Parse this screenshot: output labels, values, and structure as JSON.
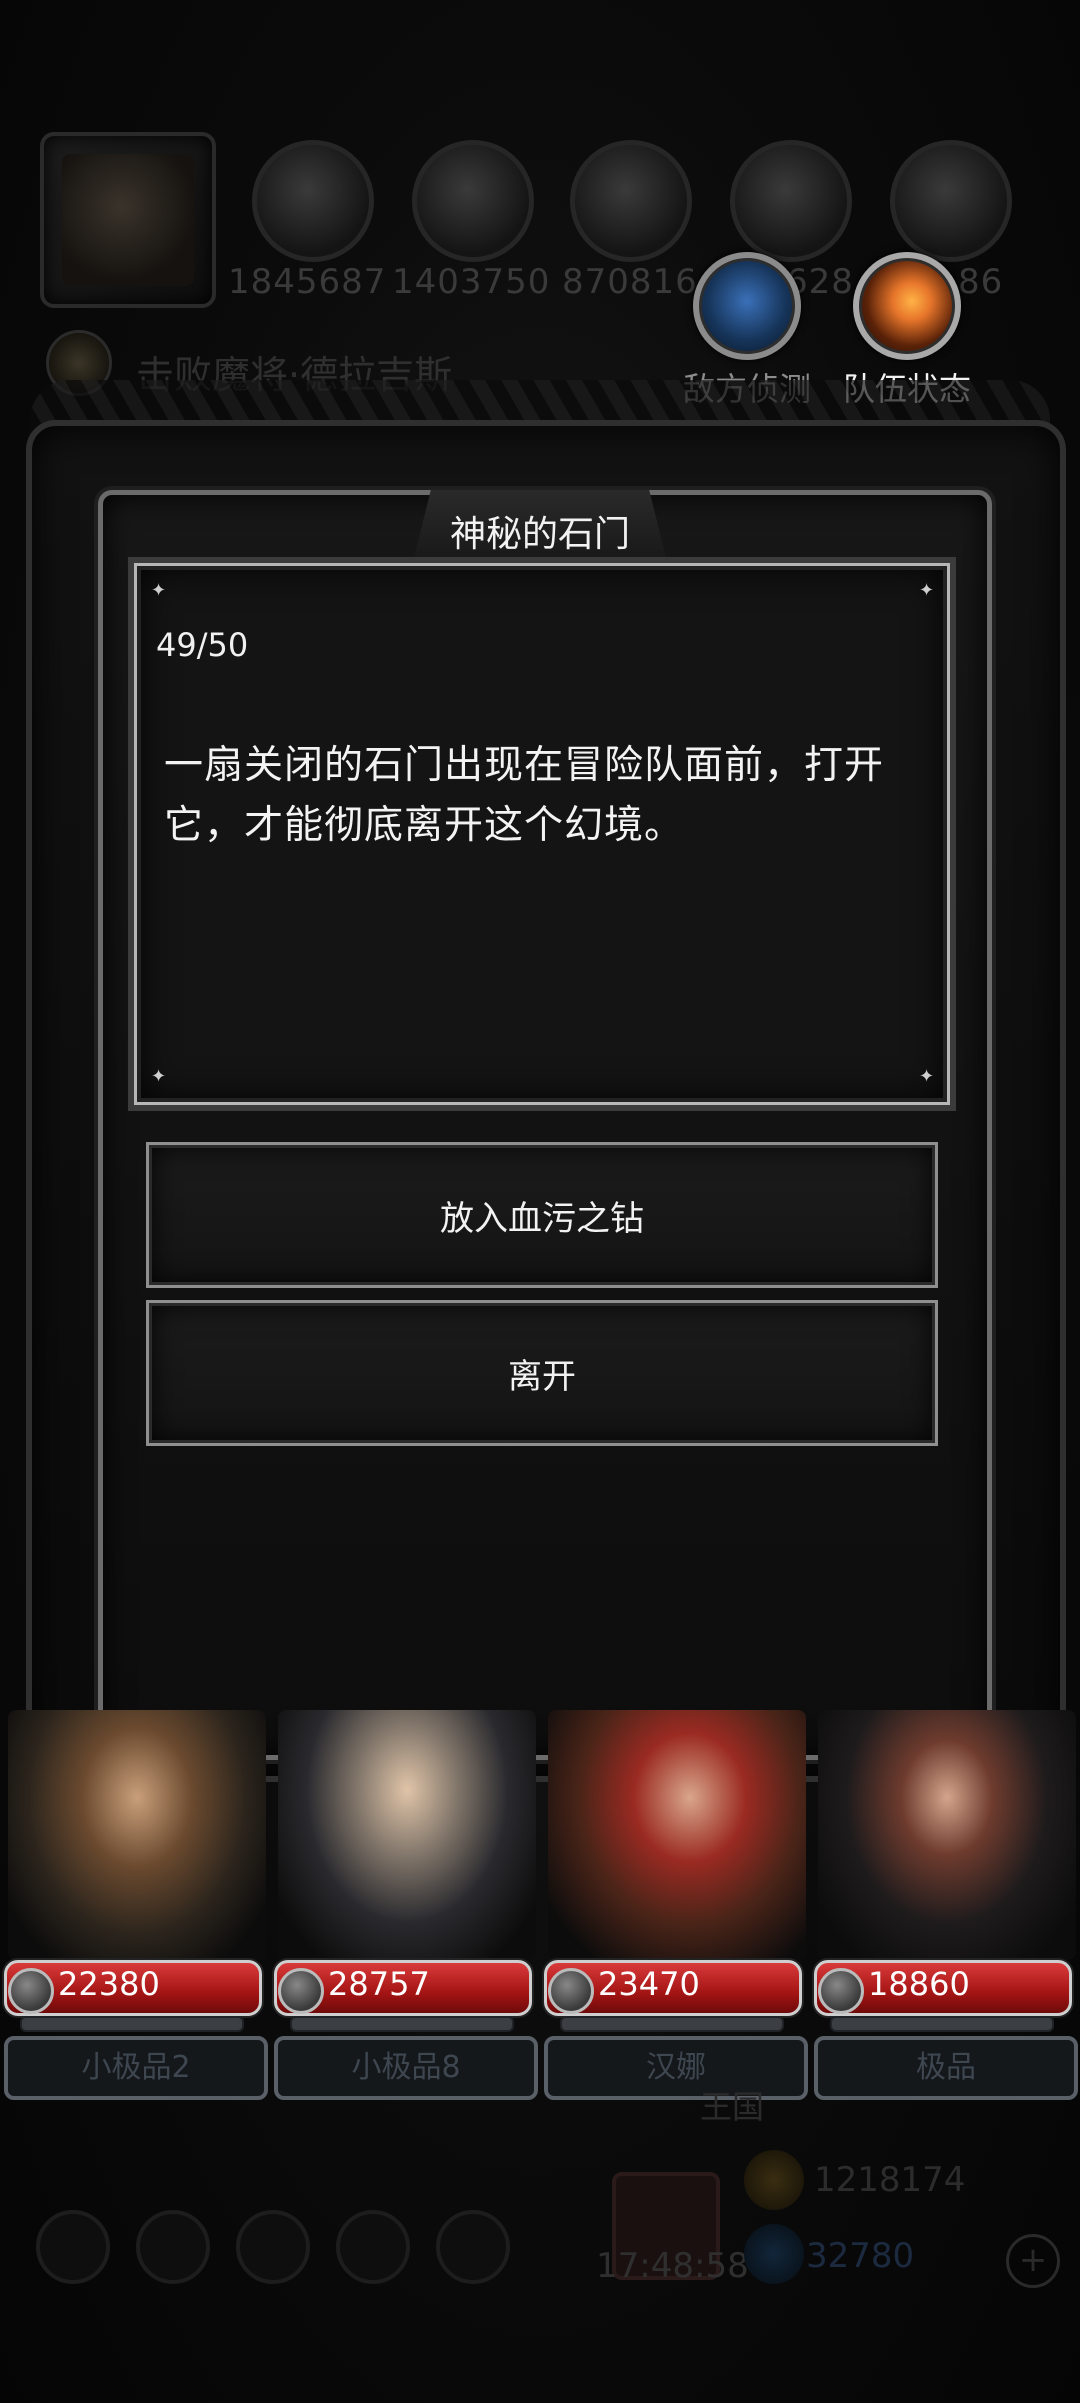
{
  "hud": {
    "stats": [
      "1845687",
      "1403750",
      "870816",
      "628",
      "86"
    ],
    "quest": "击败魔将·德拉吉斯",
    "enemy_scout_label": "敌方侦测",
    "team_status_label": "队伍状态"
  },
  "dialog": {
    "title": "神秘的石门",
    "progress": "49/50",
    "story": "一扇关闭的石门出现在冒险队面前，打开它，才能彻底离开这个幻境。",
    "choices": [
      "放入血污之钻",
      "离开"
    ]
  },
  "heroes": [
    {
      "name": "小极品2",
      "hp": "22380"
    },
    {
      "name": "小极品8",
      "hp": "28757"
    },
    {
      "name": "汉娜",
      "hp": "23470"
    },
    {
      "name": "极品",
      "hp": "18860"
    }
  ],
  "bottom": {
    "kingdom": "王国",
    "clock": "17:48:58",
    "gold": "1218174",
    "gems": "32780"
  },
  "colors": {
    "hp_red": "#b01818",
    "frame_gray": "#6b6b6b",
    "accent_orange": "#e7762b",
    "scout_blue": "#2a5d9a"
  }
}
